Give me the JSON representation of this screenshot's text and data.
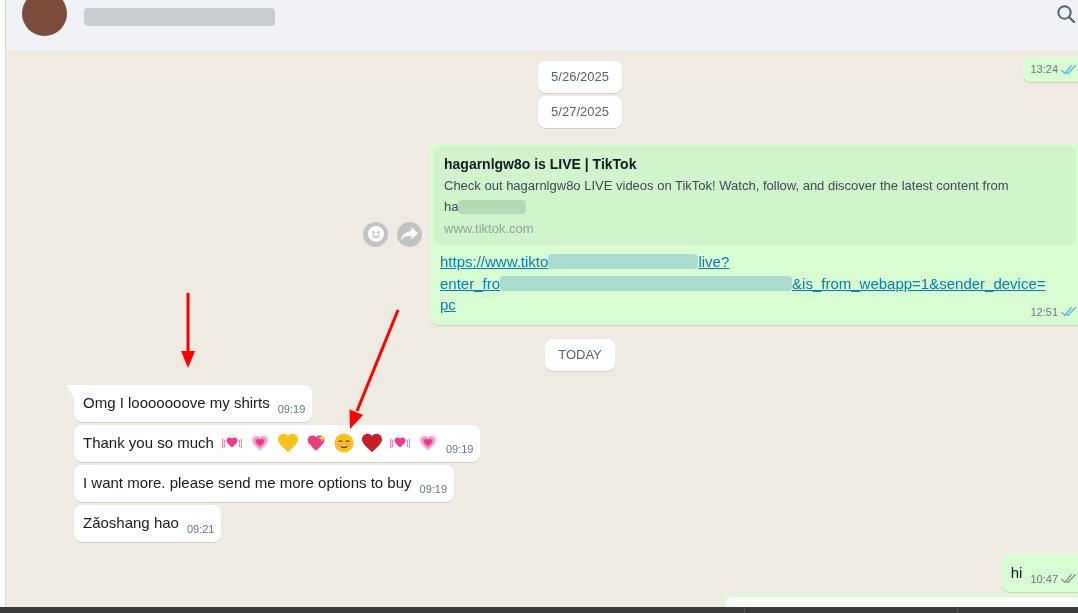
{
  "chat": {
    "floating_date": "5/26/2025",
    "items": [
      {
        "kind": "outgoing",
        "time": "13:24",
        "read": true
      },
      {
        "kind": "date",
        "text": "5/27/2025"
      },
      {
        "kind": "link_preview",
        "title": "hagarnlgw8o is LIVE | TikTok",
        "description_lines": [
          "Check out hagarnlgw8o LIVE videos on TikTok! Watch, follow, and discover the latest content from",
          "ha"
        ],
        "domain": "www.tiktok.com",
        "link_lines": [
          [
            "https://www.tikto",
            "live?"
          ],
          [
            "enter_fro",
            "&is_from_webapp=1&sender_device="
          ],
          [
            "pc"
          ]
        ],
        "time": "12:51",
        "read": true
      },
      {
        "kind": "date",
        "text": "TODAY"
      },
      {
        "kind": "incoming",
        "text": "Omg I looooooove my shirts",
        "time": "09:19",
        "tail": true
      },
      {
        "kind": "incoming",
        "text": "Thank you so much",
        "emojis": [
          {
            "kind": "beating_heart"
          },
          {
            "kind": "growing_heart"
          },
          {
            "kind": "yellow_heart"
          },
          {
            "kind": "sparkling_heart"
          },
          {
            "kind": "smiling_face"
          },
          {
            "kind": "red_heart"
          },
          {
            "kind": "beating_heart"
          },
          {
            "kind": "growing_heart"
          }
        ],
        "time": "09:19",
        "tail": false
      },
      {
        "kind": "incoming",
        "text": "I want more. please send me more options to buy",
        "time": "09:19",
        "tail": false
      },
      {
        "kind": "incoming",
        "text": "Zǎoshang hao",
        "time": "09:21",
        "tail": false
      },
      {
        "kind": "outgoing",
        "text": "hi",
        "time": "10:47",
        "read": false
      }
    ]
  }
}
